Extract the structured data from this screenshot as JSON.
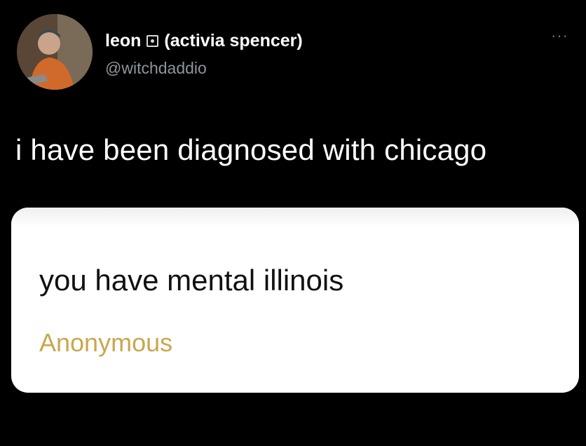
{
  "author": {
    "display_name": "leon",
    "display_name_suffix": "(activia spencer)",
    "handle": "@witchdaddio",
    "avatar": "user-avatar"
  },
  "tweet": {
    "text": "i have been diagnosed with chicago",
    "more_label": "···"
  },
  "card": {
    "question": "you have mental illinois",
    "asker": "Anonymous",
    "asker_color": "#c8a84e"
  },
  "colors": {
    "background": "#000000",
    "text_primary": "#ffffff",
    "text_secondary": "#8e959b",
    "card_bg": "#ffffff"
  }
}
